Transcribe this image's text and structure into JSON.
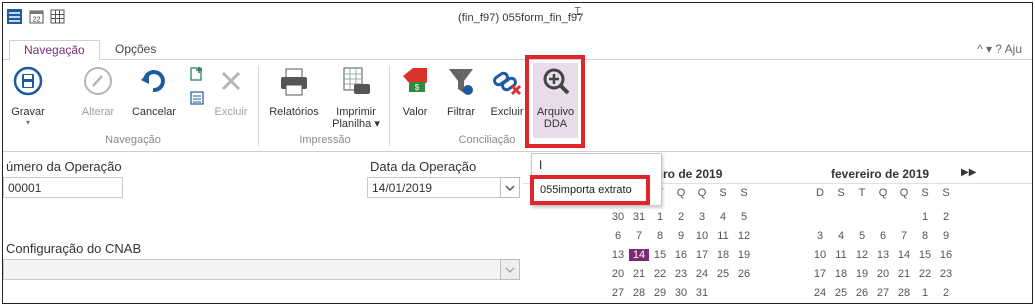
{
  "window": {
    "title": "(fin_f97) 055form_fin_f97"
  },
  "tabs": {
    "active": "Navegação",
    "other": "Opções",
    "right_controls": "^ ▾ ? Aju"
  },
  "ribbon": {
    "gravar": "Gravar",
    "alterar": "Alterar",
    "cancelar": "Cancelar",
    "excluir": "Excluir",
    "relatorios": "Relatórios",
    "imprimir_l1": "Imprimir",
    "imprimir_l2": "Planilha ▾",
    "valor": "Valor",
    "filtrar": "Filtrar",
    "excluir2": "Excluir",
    "arquivo_l1": "Arquivo",
    "arquivo_l2": "DDA",
    "group_navegacao": "Navegação",
    "group_impressao": "Impressão",
    "group_conciliacao": "Conciliação"
  },
  "form": {
    "numero_label": "úmero da Operação",
    "numero_value": "00001",
    "data_label": "Data da Operação",
    "data_value": "14/01/2019",
    "cnab_label": "Configuração do CNAB",
    "cnab_value": ""
  },
  "popup": {
    "typed": "I",
    "item": "055importa extrato"
  },
  "calendar": {
    "month1": "eiro de 2019",
    "month2": "fevereiro de 2019",
    "next": "▶▶",
    "dow1": [
      "T",
      "Q",
      "Q",
      "S",
      "S"
    ],
    "dow2": [
      "D",
      "S",
      "T",
      "Q",
      "Q",
      "S",
      "S"
    ],
    "weeks1": [
      [
        "30",
        "31",
        "1",
        "2",
        "3",
        "4",
        "5"
      ],
      [
        "6",
        "7",
        "8",
        "9",
        "10",
        "11",
        "12"
      ],
      [
        "13",
        "14",
        "15",
        "16",
        "17",
        "18",
        "19"
      ],
      [
        "20",
        "21",
        "22",
        "23",
        "24",
        "25",
        "26"
      ],
      [
        "27",
        "28",
        "29",
        "30",
        "31",
        "",
        ""
      ]
    ],
    "weeks2": [
      [
        "",
        "",
        "",
        "",
        "",
        "1",
        "2"
      ],
      [
        "3",
        "4",
        "5",
        "6",
        "7",
        "8",
        "9"
      ],
      [
        "10",
        "11",
        "12",
        "13",
        "14",
        "15",
        "16"
      ],
      [
        "17",
        "18",
        "19",
        "20",
        "21",
        "22",
        "23"
      ],
      [
        "24",
        "25",
        "26",
        "27",
        "28",
        "1",
        "2"
      ]
    ],
    "selected_day": "14",
    "accent": "#7a2b73"
  },
  "colors": {
    "highlight": "#e0262d",
    "accent": "#7a2b73",
    "ribbon_blue": "#1f5a9e"
  }
}
